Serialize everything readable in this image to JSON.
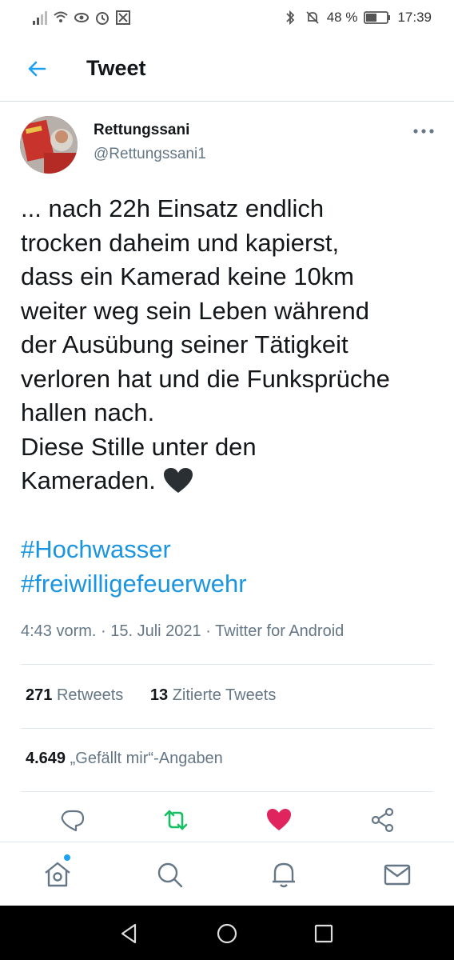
{
  "status_bar": {
    "battery": "48 %",
    "time": "17:39",
    "icons_left": [
      "signal-icon",
      "wifi-icon",
      "eye-icon",
      "alarm-icon",
      "app-notification-icon"
    ],
    "icons_right": [
      "bluetooth-icon",
      "mute-icon",
      "battery-icon"
    ]
  },
  "header": {
    "title": "Tweet"
  },
  "tweet": {
    "display_name": "Rettungssani",
    "handle": "@Rettungssani1",
    "text_lines": [
      "... nach 22h Einsatz endlich",
      "trocken daheim und kapierst,",
      "dass ein Kamerad keine 10km",
      "weiter weg sein Leben während",
      "der Ausübung seiner Tätigkeit",
      "verloren hat und die Funksprüche",
      "hallen nach.",
      "Diese Stille unter den",
      "Kameraden."
    ],
    "hashtags": [
      "#Hochwasser",
      "#freiwilligefeuerwehr"
    ],
    "meta": "4:43 vorm. · 15. Juli 2021 · Twitter for Android"
  },
  "stats": {
    "retweets_count": "271",
    "retweets_label": "Retweets",
    "quotes_count": "13",
    "quotes_label": "Zitierte Tweets",
    "likes_count": "4.649",
    "likes_label": "„Gefällt mir“-Angaben"
  },
  "colors": {
    "accent": "#1da1f2",
    "link": "#1b95e0",
    "retweet": "#17bf63",
    "like": "#e0245e",
    "muted": "#657786"
  }
}
